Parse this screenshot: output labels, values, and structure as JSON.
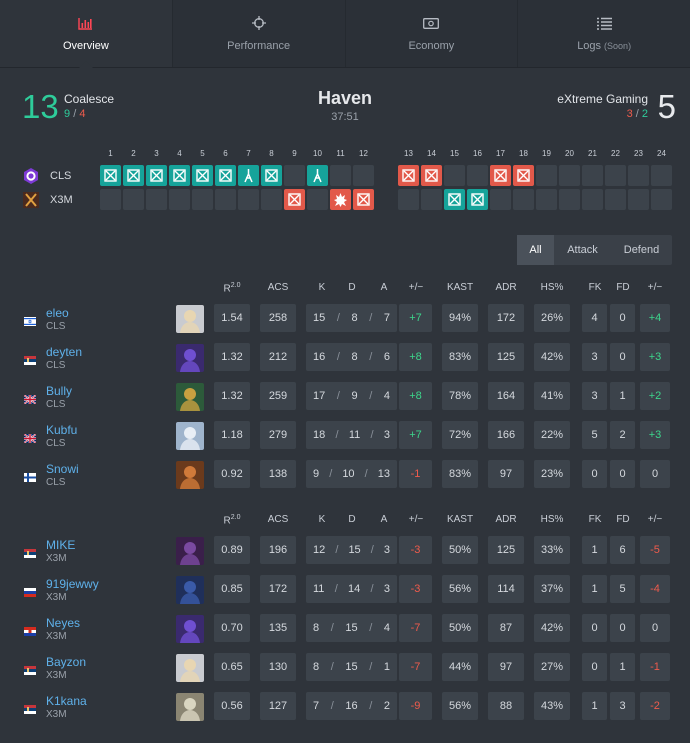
{
  "tabs": [
    {
      "label": "Overview",
      "icon": "bar-chart-icon",
      "active": true
    },
    {
      "label": "Performance",
      "icon": "crosshair-icon"
    },
    {
      "label": "Economy",
      "icon": "money-icon"
    },
    {
      "label": "Logs",
      "soon": "(Soon)",
      "icon": "list-icon"
    }
  ],
  "match": {
    "map": "Haven",
    "duration": "37:51",
    "left": {
      "name": "Coalesce",
      "score": "13",
      "ct_half": "9",
      "t_half": "4",
      "sep": "/"
    },
    "right": {
      "name": "eXtreme Gaming",
      "score": "5",
      "t_half": "3",
      "ct_half": "2",
      "sep": "/"
    }
  },
  "rounds": {
    "numbers": [
      "1",
      "2",
      "3",
      "4",
      "5",
      "6",
      "7",
      "8",
      "9",
      "10",
      "11",
      "12",
      "13",
      "14",
      "15",
      "16",
      "17",
      "18",
      "19",
      "20",
      "21",
      "22",
      "23",
      "24"
    ],
    "teams": [
      {
        "tag": "CLS",
        "logo": "coalesce-logo",
        "results": [
          "ct-defuse",
          "ct-defuse",
          "ct-defuse",
          "ct-defuse",
          "ct-defuse",
          "ct-defuse",
          "ct-elim",
          "ct-defuse",
          "",
          "ct-elim",
          "",
          "",
          "t-defuse",
          "t-defuse",
          "",
          "",
          "t-defuse",
          "t-defuse",
          "",
          "",
          "",
          "",
          "",
          ""
        ]
      },
      {
        "tag": "X3M",
        "logo": "x3m-logo",
        "results": [
          "",
          "",
          "",
          "",
          "",
          "",
          "",
          "",
          "t-defuse",
          "",
          "t-explode",
          "t-defuse",
          "",
          "",
          "ct-defuse",
          "ct-defuse",
          "",
          "",
          "",
          "",
          "",
          "",
          "",
          ""
        ]
      }
    ]
  },
  "filter": {
    "all": "All",
    "attack": "Attack",
    "defend": "Defend"
  },
  "columns": {
    "rating": "R",
    "rating_sup": "2.0",
    "acs": "ACS",
    "k": "K",
    "d": "D",
    "a": "A",
    "pm": "+/−",
    "kast": "KAST",
    "adr": "ADR",
    "hs": "HS%",
    "fk": "FK",
    "fd": "FD",
    "fpm": "+/−"
  },
  "team1": [
    {
      "name": "eleo",
      "team": "CLS",
      "flag": "israel",
      "agent": "sova",
      "rating": "1.54",
      "acs": "258",
      "k": "15",
      "d": "8",
      "a": "7",
      "pm": "+7",
      "kast": "94%",
      "adr": "172",
      "hs": "26%",
      "fk": "4",
      "fd": "0",
      "fpm": "+4"
    },
    {
      "name": "deyten",
      "team": "CLS",
      "flag": "serbia",
      "agent": "omen",
      "rating": "1.32",
      "acs": "212",
      "k": "16",
      "d": "8",
      "a": "6",
      "pm": "+8",
      "kast": "83%",
      "adr": "125",
      "hs": "42%",
      "fk": "3",
      "fd": "0",
      "fpm": "+3"
    },
    {
      "name": "Bully",
      "team": "CLS",
      "flag": "uk",
      "agent": "skye",
      "rating": "1.32",
      "acs": "259",
      "k": "17",
      "d": "9",
      "a": "4",
      "pm": "+8",
      "kast": "78%",
      "adr": "164",
      "hs": "41%",
      "fk": "3",
      "fd": "1",
      "fpm": "+2"
    },
    {
      "name": "Kubfu",
      "team": "CLS",
      "flag": "uk",
      "agent": "jett",
      "rating": "1.18",
      "acs": "279",
      "k": "18",
      "d": "11",
      "a": "3",
      "pm": "+7",
      "kast": "72%",
      "adr": "166",
      "hs": "22%",
      "fk": "5",
      "fd": "2",
      "fpm": "+3"
    },
    {
      "name": "Snowi",
      "team": "CLS",
      "flag": "finland",
      "agent": "breach",
      "rating": "0.92",
      "acs": "138",
      "k": "9",
      "d": "10",
      "a": "13",
      "pm": "-1",
      "kast": "83%",
      "adr": "97",
      "hs": "23%",
      "fk": "0",
      "fd": "0",
      "fpm": "0"
    }
  ],
  "team2": [
    {
      "name": "MIKE",
      "team": "X3M",
      "flag": "serbia",
      "agent": "reyna",
      "rating": "0.89",
      "acs": "196",
      "k": "12",
      "d": "15",
      "a": "3",
      "pm": "-3",
      "kast": "50%",
      "adr": "125",
      "hs": "33%",
      "fk": "1",
      "fd": "6",
      "fpm": "-5"
    },
    {
      "name": "919jewwy",
      "team": "X3M",
      "flag": "russia",
      "agent": "yoru",
      "rating": "0.85",
      "acs": "172",
      "k": "11",
      "d": "14",
      "a": "3",
      "pm": "-3",
      "kast": "56%",
      "adr": "114",
      "hs": "37%",
      "fk": "1",
      "fd": "5",
      "fpm": "-4"
    },
    {
      "name": "Neyes",
      "team": "X3M",
      "flag": "croatia",
      "agent": "omen",
      "rating": "0.70",
      "acs": "135",
      "k": "8",
      "d": "15",
      "a": "4",
      "pm": "-7",
      "kast": "50%",
      "adr": "87",
      "hs": "42%",
      "fk": "0",
      "fd": "0",
      "fpm": "0"
    },
    {
      "name": "Bayzon",
      "team": "X3M",
      "flag": "serbia",
      "agent": "sova",
      "rating": "0.65",
      "acs": "130",
      "k": "8",
      "d": "15",
      "a": "1",
      "pm": "-7",
      "kast": "44%",
      "adr": "97",
      "hs": "27%",
      "fk": "0",
      "fd": "1",
      "fpm": "-1"
    },
    {
      "name": "K1kana",
      "team": "X3M",
      "flag": "serbia",
      "agent": "cypher",
      "rating": "0.56",
      "acs": "127",
      "k": "7",
      "d": "16",
      "a": "2",
      "pm": "-9",
      "kast": "56%",
      "adr": "88",
      "hs": "43%",
      "fk": "1",
      "fd": "3",
      "fpm": "-2"
    }
  ],
  "colors": {
    "ct": "#16a39a",
    "t": "#e2594a",
    "positive": "#3dd68c",
    "negative": "#ef5b4c",
    "name": "#5fb1ea",
    "score_win": "#2ecc9a"
  }
}
